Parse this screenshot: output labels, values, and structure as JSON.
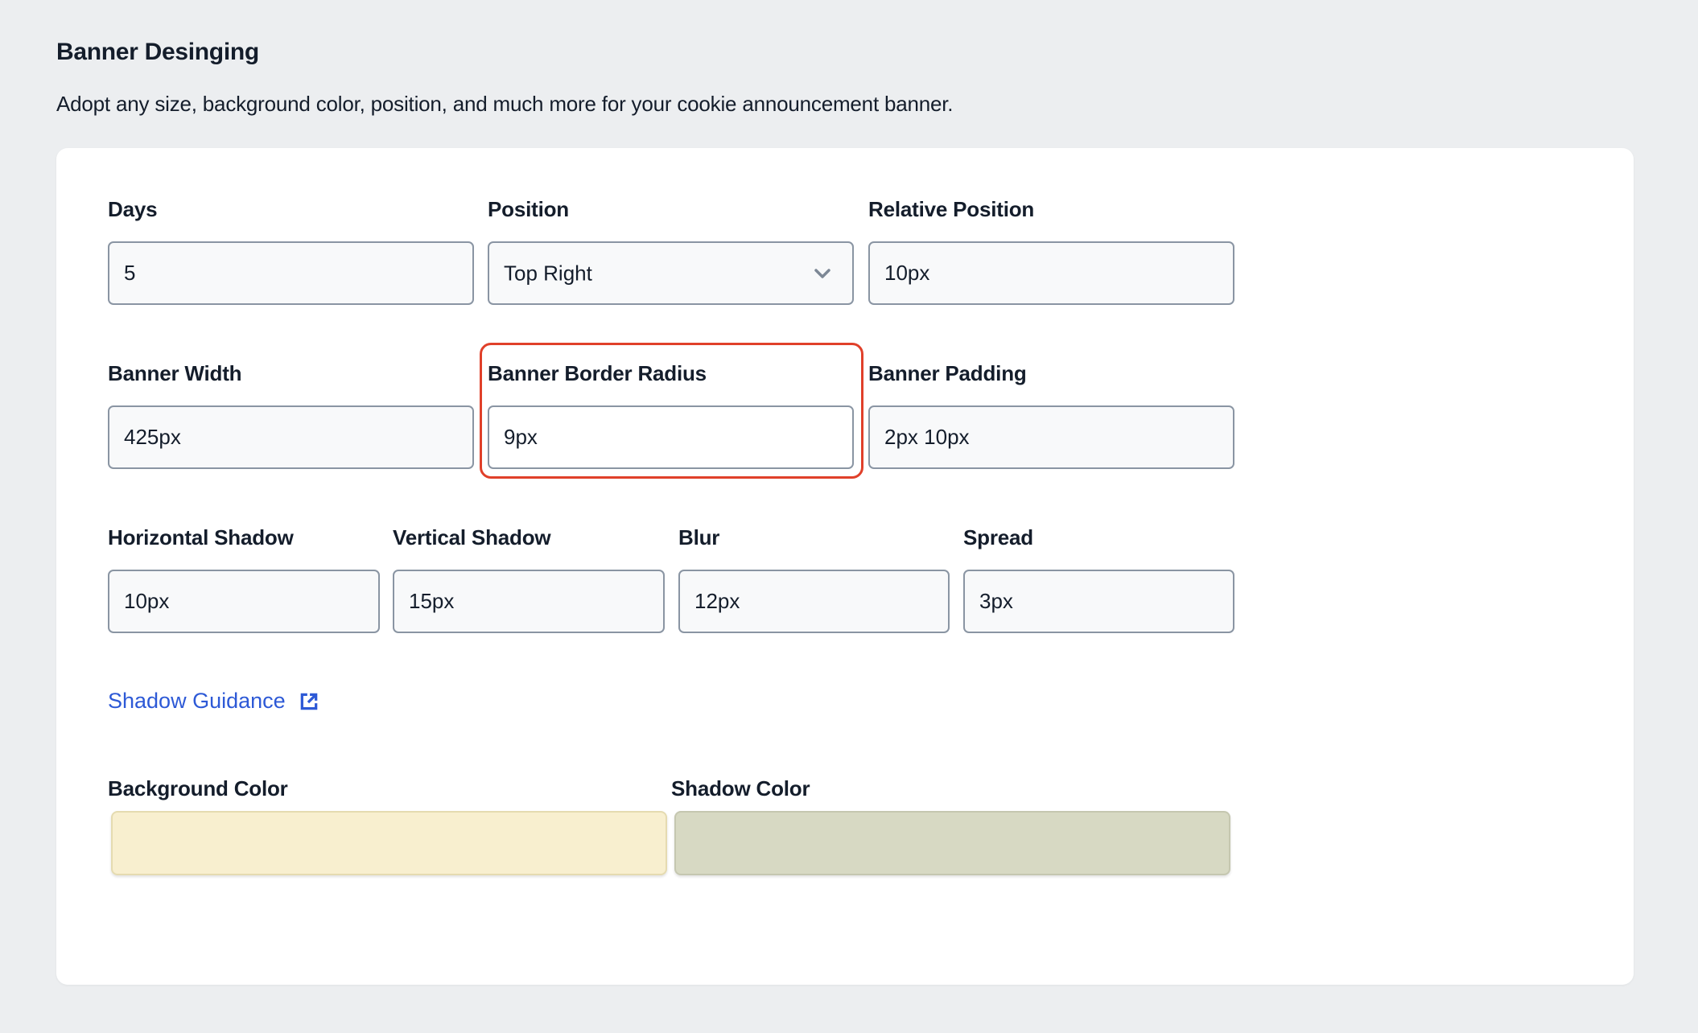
{
  "section": {
    "title": "Banner Desinging",
    "description": "Adopt any size, background color, position, and much more for your cookie announcement banner."
  },
  "fields": {
    "days": {
      "label": "Days",
      "value": "5"
    },
    "position": {
      "label": "Position",
      "value": "Top Right"
    },
    "relative_position": {
      "label": "Relative Position",
      "value": "10px"
    },
    "banner_width": {
      "label": "Banner Width",
      "value": "425px"
    },
    "banner_border_radius": {
      "label": "Banner Border Radius",
      "value": "9px"
    },
    "banner_padding": {
      "label": "Banner Padding",
      "value": "2px 10px"
    },
    "horizontal_shadow": {
      "label": "Horizontal Shadow",
      "value": "10px"
    },
    "vertical_shadow": {
      "label": "Vertical Shadow",
      "value": "15px"
    },
    "blur": {
      "label": "Blur",
      "value": "12px"
    },
    "spread": {
      "label": "Spread",
      "value": "3px"
    }
  },
  "link": {
    "label": "Shadow Guidance",
    "icon": "external-link-icon"
  },
  "colors": {
    "background_color": {
      "label": "Background Color",
      "value": "#f8efcf",
      "border": "#e5dbb0"
    },
    "shadow_color": {
      "label": "Shadow Color",
      "value": "#d7d9c3",
      "border": "#c5c7b0"
    }
  },
  "theme": {
    "highlight": "#e0402a",
    "link": "#2d59d6",
    "page_bg": "#eceef0"
  }
}
